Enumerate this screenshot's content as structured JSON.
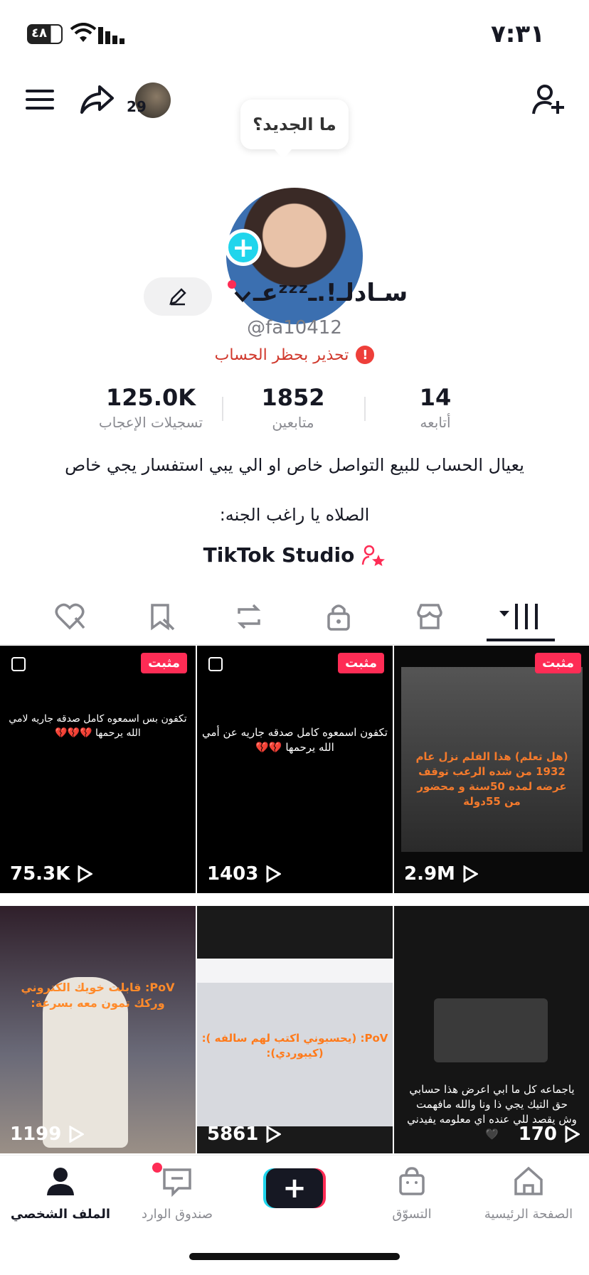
{
  "status_bar": {
    "time": "٧:٣١",
    "battery": "٤٨"
  },
  "header": {
    "story_count": "29",
    "whats_new": "ما الجديد؟",
    "username": "عـᶻᶻᶻسـادلـ!.ـ",
    "handle": "@fa10412",
    "warning": "تحذير بحظر الحساب"
  },
  "stats": [
    {
      "value": "125.0K",
      "label": "تسجيلات الإعجاب"
    },
    {
      "value": "1852",
      "label": "متابعين"
    },
    {
      "value": "14",
      "label": "أتابعه"
    }
  ],
  "bio": {
    "line1": "يعيال الحساب للبيع التواصل خاص او الي يبي استفسار يجي خاص",
    "line2": "الصلاه يا راغب الجنه:",
    "studio_link": "TikTok Studio"
  },
  "tabs": [
    "videos-grid",
    "shop",
    "private",
    "reposts",
    "favorites",
    "liked"
  ],
  "videos": [
    {
      "pinned_label": "مثبت",
      "count": "75.3K",
      "text": "تكفون بس اسمعوه كامل صدقه جاريه لامي الله يرحمها 💔💔💔"
    },
    {
      "pinned_label": "مثبت",
      "count": "1403",
      "text": "تكفون اسمعوه كامل صدقه جاريه عن أمي الله يرحمها 💔💔"
    },
    {
      "pinned_label": "مثبت",
      "count": "2.9M",
      "text": "(هل تعلم) هذا الفلم نزل عام 1932 من شده الرعب توقف عرضه لمده 50سنة و محضور من 55دولة"
    },
    {
      "count": "1199",
      "text": "PoV: قابلت خويك الكتروني وركك تمون معه بسرعة:"
    },
    {
      "count": "5861",
      "text": "PoV: (يحسبوني اكتب لهم سالفه ): (كيبوردي):"
    },
    {
      "count": "170",
      "text": "ياجماعه كل ما ابي اعرض هذا حسابي حق التيك يجي ذا ونا والله مافهمت وش يقصد للي عنده اي معلومه يفيدني 🖤"
    }
  ],
  "bottom_nav": [
    {
      "label": "الصفحة الرئيسية"
    },
    {
      "label": "التسوّق"
    },
    {
      "label": "صندوق الوارد"
    },
    {
      "label": "الملف الشخصي"
    }
  ],
  "colors": {
    "accent": "#fe2c55",
    "cyan": "#20d5ec",
    "warning": "#d0382c"
  }
}
